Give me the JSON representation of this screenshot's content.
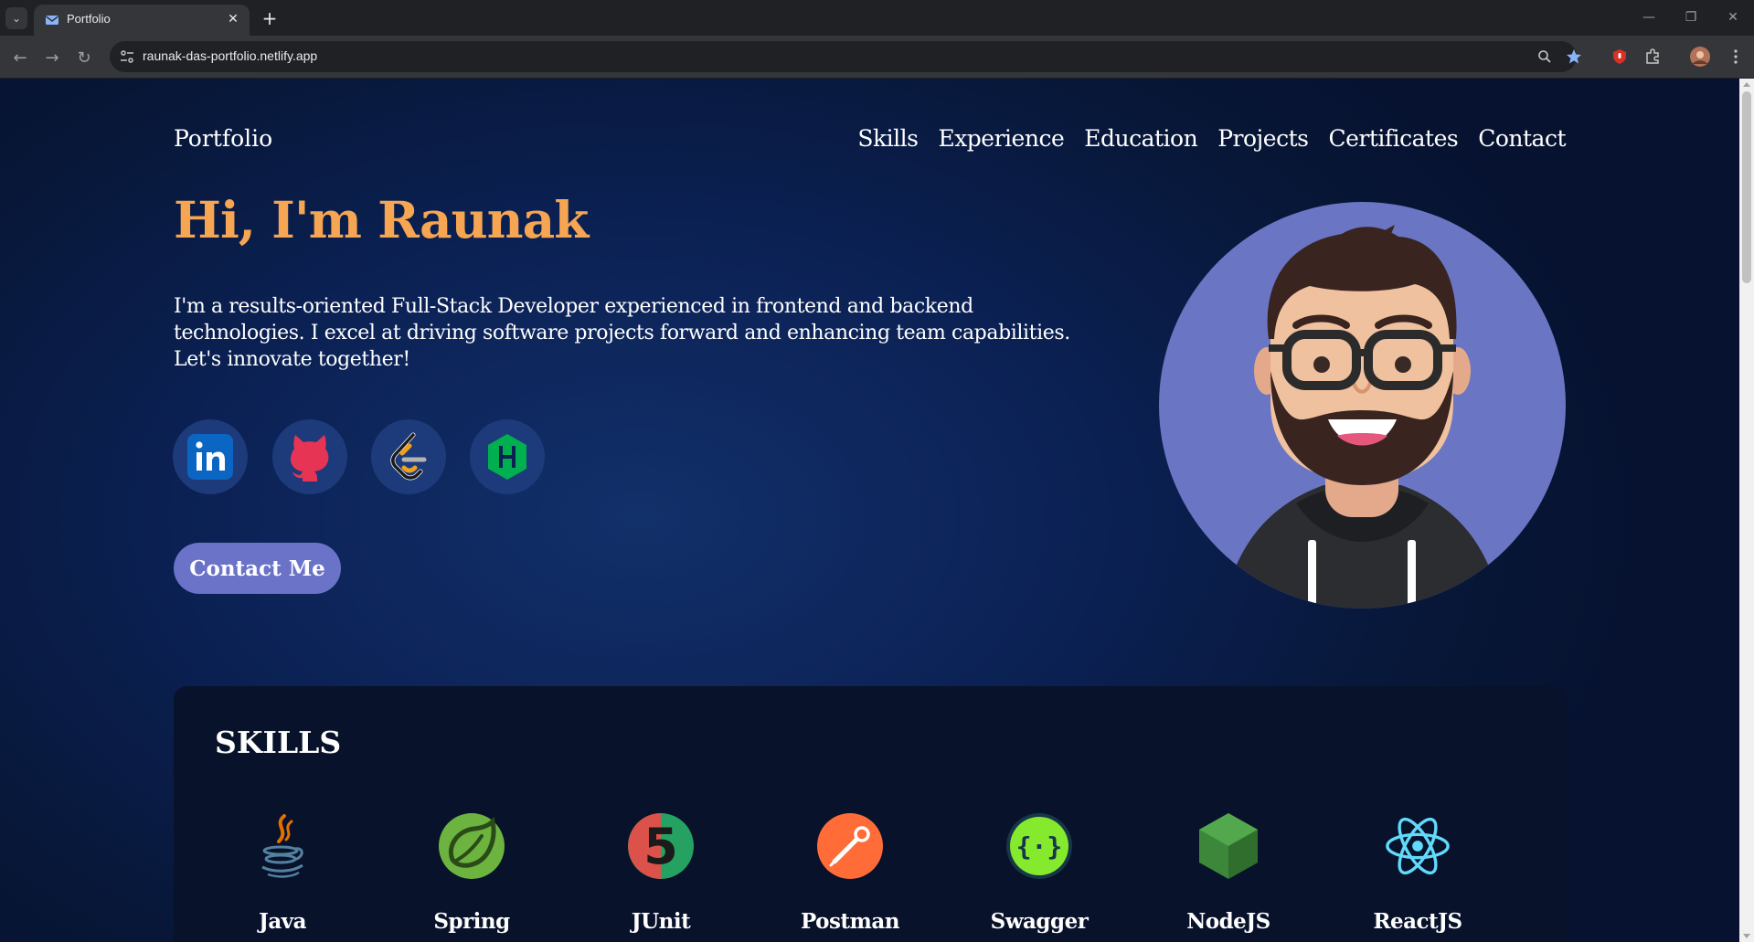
{
  "browser": {
    "tab_title": "Portfolio",
    "url": "raunak-das-portfolio.netlify.app"
  },
  "header": {
    "brand": "Portfolio",
    "nav": [
      "Skills",
      "Experience",
      "Education",
      "Projects",
      "Certificates",
      "Contact"
    ]
  },
  "hero": {
    "title": "Hi, I'm Raunak",
    "description": "I'm a results-oriented Full-Stack Developer experienced in frontend and backend technologies. I excel at driving software projects forward and enhancing team capabilities. Let's innovate together!",
    "social_icons": [
      "linkedin-icon",
      "github-icon",
      "leetcode-icon",
      "hackerrank-icon"
    ],
    "contact_button": "Contact Me"
  },
  "skills": {
    "title": "SKILLS",
    "items": [
      "Java",
      "Spring",
      "JUnit",
      "Postman",
      "Swagger",
      "NodeJS",
      "ReactJS"
    ]
  },
  "colors": {
    "accent": "#f6a552",
    "button": "#6b73c9",
    "background": "#0b2154",
    "card": "#08122a"
  }
}
